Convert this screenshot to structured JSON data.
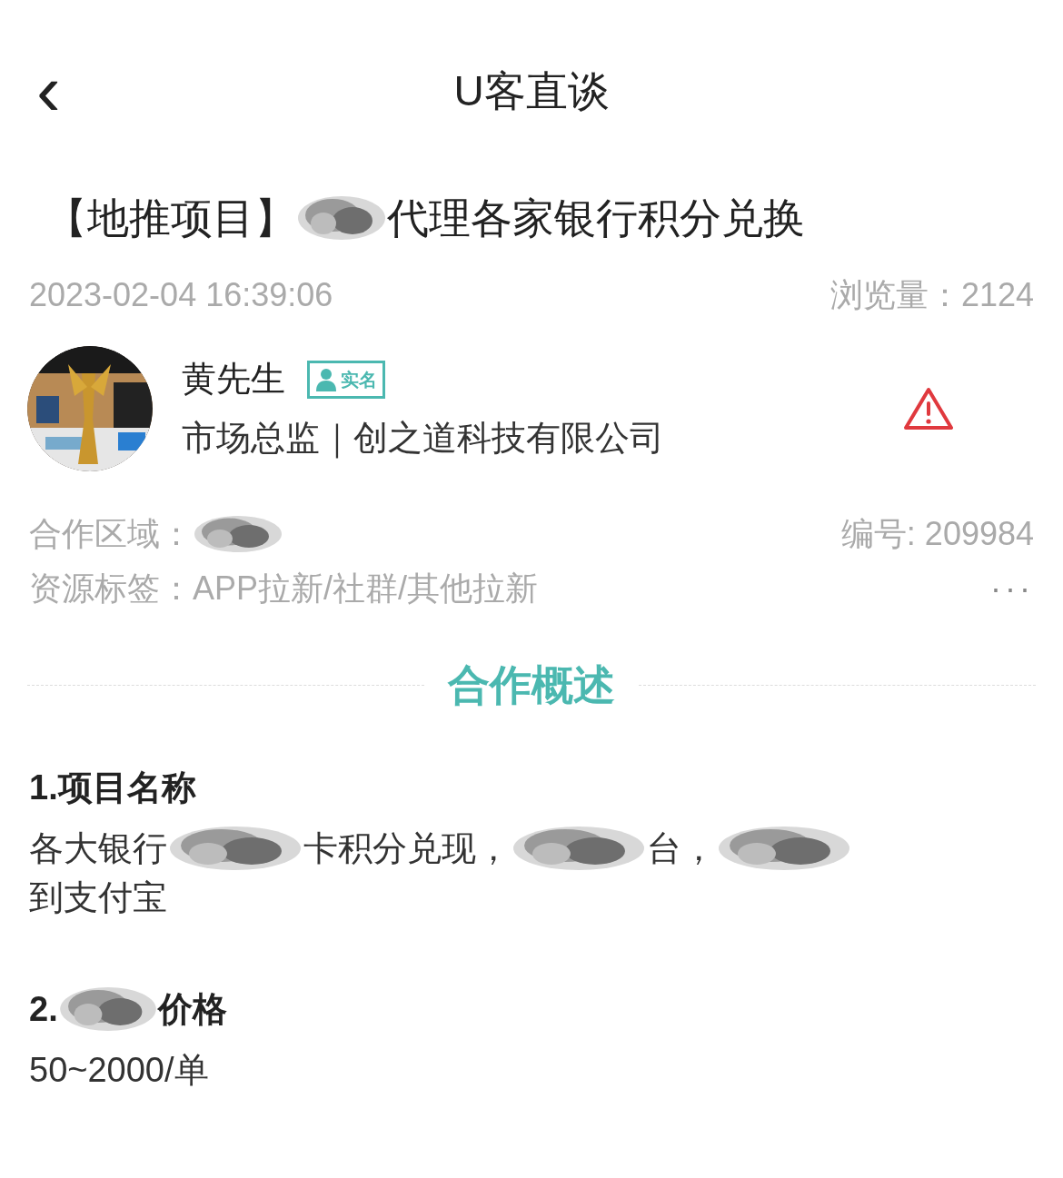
{
  "nav": {
    "back_icon": "‹",
    "title": "U客直谈"
  },
  "post": {
    "title_parts": [
      {
        "kind": "text",
        "text": "【地推项目】"
      },
      {
        "kind": "scribble"
      },
      {
        "kind": "text",
        "text": "代理各家银行积分兑换"
      }
    ],
    "time": "2023-02-04 16:39:06",
    "views_label": "浏览量：",
    "views": "2124"
  },
  "author": {
    "name": "黄先生",
    "verified_badge": "实名",
    "verified": true,
    "role": "市场总监｜创之道科技有限公司"
  },
  "meta": {
    "region_label": "合作区域：",
    "region_parts": [
      {
        "kind": "scribble"
      }
    ],
    "number": "编号: 209984",
    "tags_label": "资源标签：",
    "tags": "APP拉新/社群/其他拉新",
    "more": "···"
  },
  "section_title": "合作概述",
  "items": [
    {
      "heading_parts": [
        {
          "kind": "text",
          "text": "1.项目名称"
        }
      ],
      "body_lines": [
        [
          {
            "kind": "text",
            "text": "各大银行"
          },
          {
            "kind": "scribble"
          },
          {
            "kind": "text",
            "text": "卡积分兑现，"
          },
          {
            "kind": "scribble"
          },
          {
            "kind": "text",
            "text": "台，"
          },
          {
            "kind": "scribble"
          }
        ],
        [
          {
            "kind": "text",
            "text": "到支付宝"
          }
        ]
      ]
    },
    {
      "heading_parts": [
        {
          "kind": "text",
          "text": "2."
        },
        {
          "kind": "scribble"
        },
        {
          "kind": "text",
          "text": "价格"
        }
      ],
      "body_lines": [
        [
          {
            "kind": "text",
            "text": "50~2000/单"
          }
        ]
      ]
    }
  ]
}
